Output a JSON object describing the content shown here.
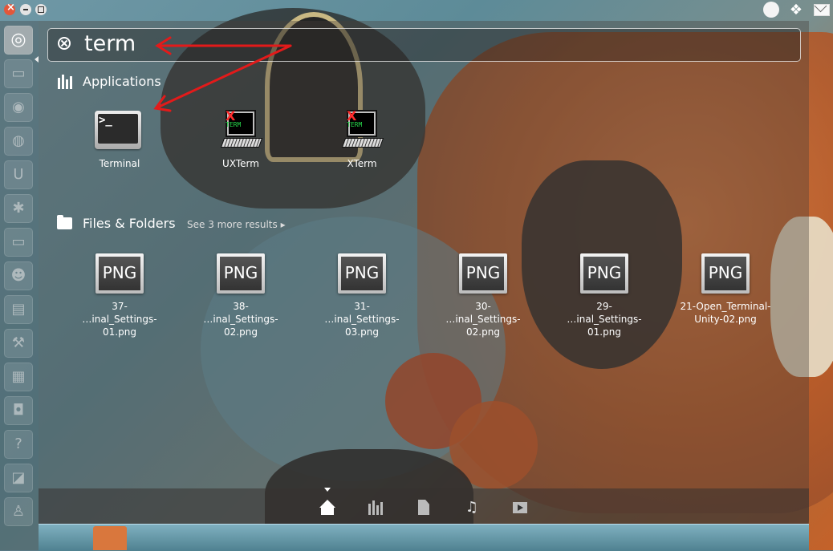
{
  "top_panel": {
    "window_controls": [
      "close",
      "minimize",
      "maximize"
    ],
    "indicators": [
      "session-circle-icon",
      "dropbox-icon",
      "mail-icon"
    ]
  },
  "search": {
    "query": "term"
  },
  "applications": {
    "header": "Applications",
    "results": [
      {
        "label": "Terminal",
        "icon": "terminal-icon"
      },
      {
        "label": "UXTerm",
        "icon": "xterm-icon"
      },
      {
        "label": "XTerm",
        "icon": "xterm-icon"
      }
    ]
  },
  "files": {
    "header": "Files & Folders",
    "see_more": "See 3 more results",
    "results": [
      {
        "line1": "37-",
        "line2": "…inal_Settings-01.png",
        "icon_text": "PNG"
      },
      {
        "line1": "38-",
        "line2": "…inal_Settings-02.png",
        "icon_text": "PNG"
      },
      {
        "line1": "31-",
        "line2": "…inal_Settings-03.png",
        "icon_text": "PNG"
      },
      {
        "line1": "30-",
        "line2": "…inal_Settings-02.png",
        "icon_text": "PNG"
      },
      {
        "line1": "29-",
        "line2": "…inal_Settings-01.png",
        "icon_text": "PNG"
      },
      {
        "line1": "21-Open_Terminal-",
        "line2": "Unity-02.png",
        "icon_text": "PNG"
      }
    ]
  },
  "lens_bar": {
    "lenses": [
      "home-lens",
      "applications-lens",
      "files-lens",
      "music-lens",
      "video-lens"
    ],
    "active": "home-lens",
    "music_glyph": "♫"
  },
  "xterm_icon": {
    "x": "X",
    "t": "TERM"
  },
  "terminal_icon": {
    "prompt": ">_"
  },
  "colors": {
    "annotation_arrow": "#e31a1a",
    "close_button": "#e2573b"
  }
}
